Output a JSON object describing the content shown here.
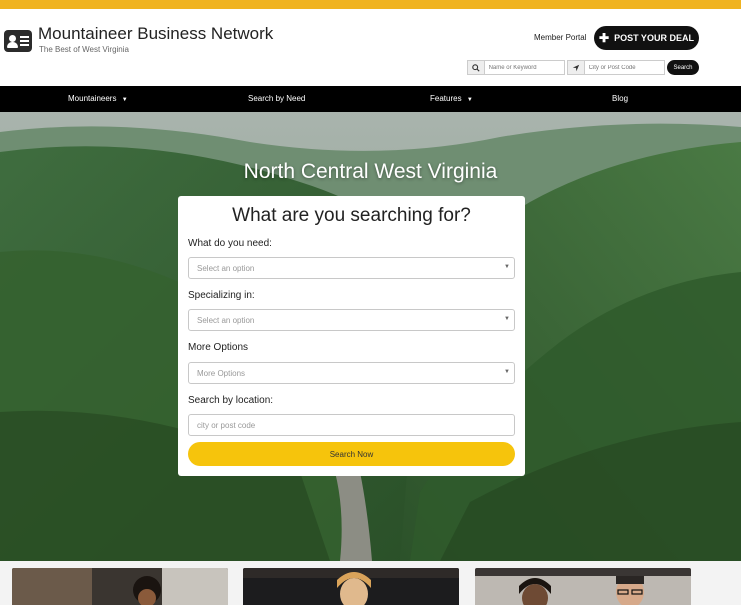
{
  "header": {
    "brand_name": "Mountaineer Business Network",
    "brand_tagline": "The Best of West Virginia",
    "member_portal": "Member Portal",
    "post_deal": "POST YOUR DEAL",
    "keyword_placeholder": "Name or Keyword",
    "location_placeholder": "City or Post Code",
    "search_label": "Search"
  },
  "nav": {
    "items": [
      "Mountaineers",
      "Search by Need",
      "Features",
      "Blog"
    ]
  },
  "hero": {
    "title": "North Central West Virginia"
  },
  "search_card": {
    "title": "What are you searching for?",
    "need_label": "What do you need:",
    "need_placeholder": "Select an option",
    "specializing_label": "Specializing in:",
    "specializing_placeholder": "Select an option",
    "more_label": "More Options",
    "more_placeholder": "More Options",
    "location_label": "Search by location:",
    "location_placeholder": "city or post code",
    "submit": "Search Now"
  },
  "colors": {
    "accent_gold": "#f0b320",
    "search_button": "#f6c40c",
    "nav_bg": "#000000"
  },
  "icons": [
    "id-card-icon",
    "plus-icon",
    "search-icon",
    "location-arrow-icon",
    "chevron-down-icon"
  ]
}
